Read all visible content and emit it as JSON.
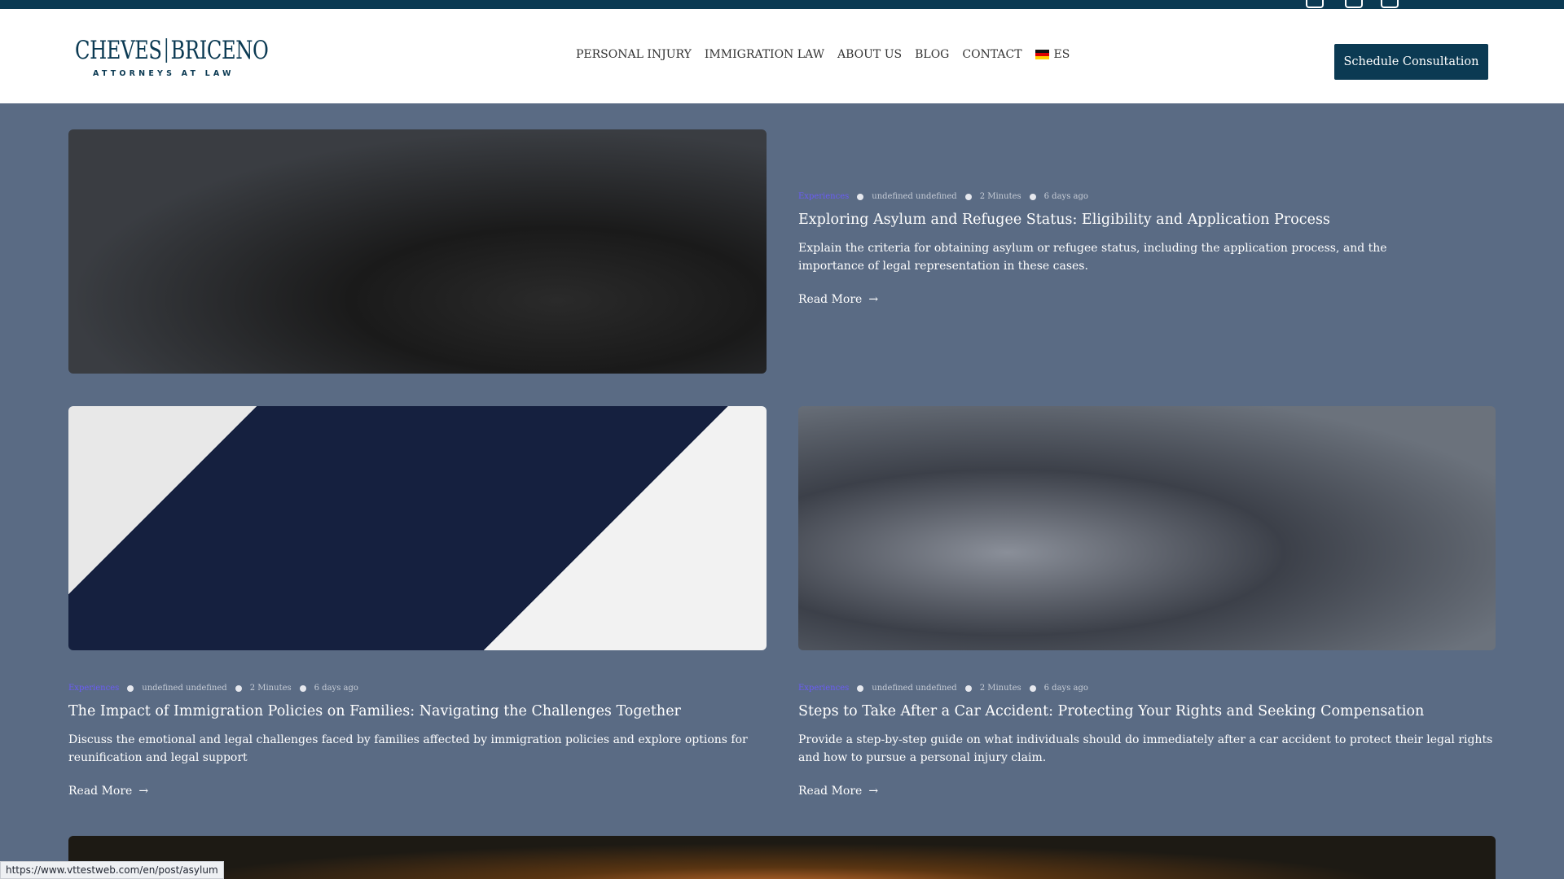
{
  "header": {
    "logo_name_left": "CHEVES",
    "logo_name_right": "BRICENO",
    "logo_sub": "ATTORNEYS AT LAW",
    "cta_label": "Schedule Consultation"
  },
  "nav": {
    "items": [
      "PERSONAL INJURY",
      "IMMIGRATION LAW",
      "ABOUT US",
      "BLOG",
      "CONTACT"
    ],
    "language": "ES"
  },
  "posts": [
    {
      "category": "Experiences",
      "author": "undefined undefined",
      "read_time": "2 Minutes",
      "date": "6 days ago",
      "title": "Exploring Asylum and Refugee Status: Eligibility and Application Process",
      "description": "Explain the criteria for obtaining asylum or refugee status, including the application process, and the importance of legal representation in these cases.",
      "read_more": "Read More"
    },
    {
      "category": "Experiences",
      "author": "undefined undefined",
      "read_time": "2 Minutes",
      "date": "6 days ago",
      "title": "The Impact of Immigration Policies on Families: Navigating the Challenges Together",
      "description": "Discuss the emotional and legal challenges faced by families affected by immigration policies and explore options for reunification and legal support",
      "read_more": "Read More"
    },
    {
      "category": "Experiences",
      "author": "undefined undefined",
      "read_time": "2 Minutes",
      "date": "6 days ago",
      "title": "Steps to Take After a Car Accident: Protecting Your Rights and Seeking Compensation",
      "description": "Provide a step-by-step guide on what individuals should do immediately after a car accident to protect their legal rights and how to pursue a personal injury claim.",
      "read_more": "Read More"
    }
  ],
  "status_url": "https://www.vttestweb.com/en/post/asylum",
  "colors": {
    "brand": "#0b3a53",
    "page_bg": "#5a6b84",
    "category": "#6a5cf5"
  }
}
